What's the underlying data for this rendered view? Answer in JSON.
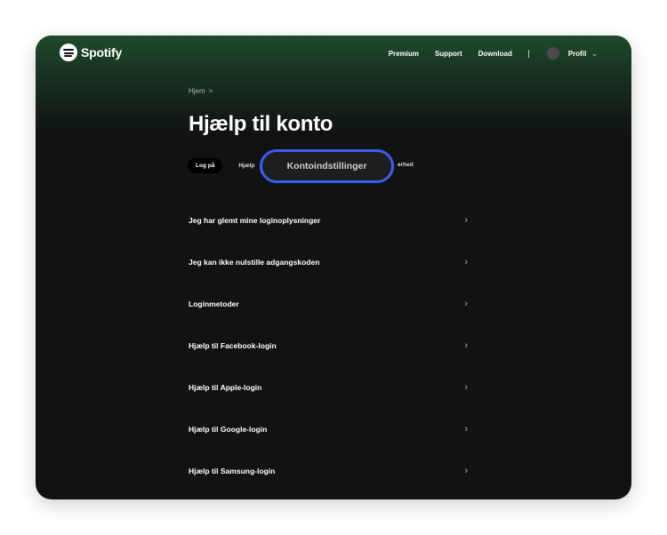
{
  "brand": {
    "name": "Spotify"
  },
  "nav": {
    "premium": "Premium",
    "support": "Support",
    "download": "Download",
    "profile": "Profil"
  },
  "breadcrumb": {
    "home": "Hjem",
    "separator": ">"
  },
  "page": {
    "title": "Hjælp til konto"
  },
  "tabs": {
    "login": "Log på",
    "help_partial": "Hjælp",
    "highlighted": "Kontoindstillinger",
    "partial_right": "erhed"
  },
  "items": [
    {
      "label": "Jeg har glemt mine loginoplysninger"
    },
    {
      "label": "Jeg kan ikke nulstille adgangskoden"
    },
    {
      "label": "Loginmetoder"
    },
    {
      "label": "Hjælp til Facebook-login"
    },
    {
      "label": "Hjælp til Apple-login"
    },
    {
      "label": "Hjælp til Google-login"
    },
    {
      "label": "Hjælp til Samsung-login"
    }
  ],
  "colors": {
    "background": "#121212",
    "highlight": "#3a5ff0",
    "hero_green": "#1f4a2b"
  },
  "icons": {
    "chevron_right": "›",
    "chevron_down": "⌄"
  }
}
